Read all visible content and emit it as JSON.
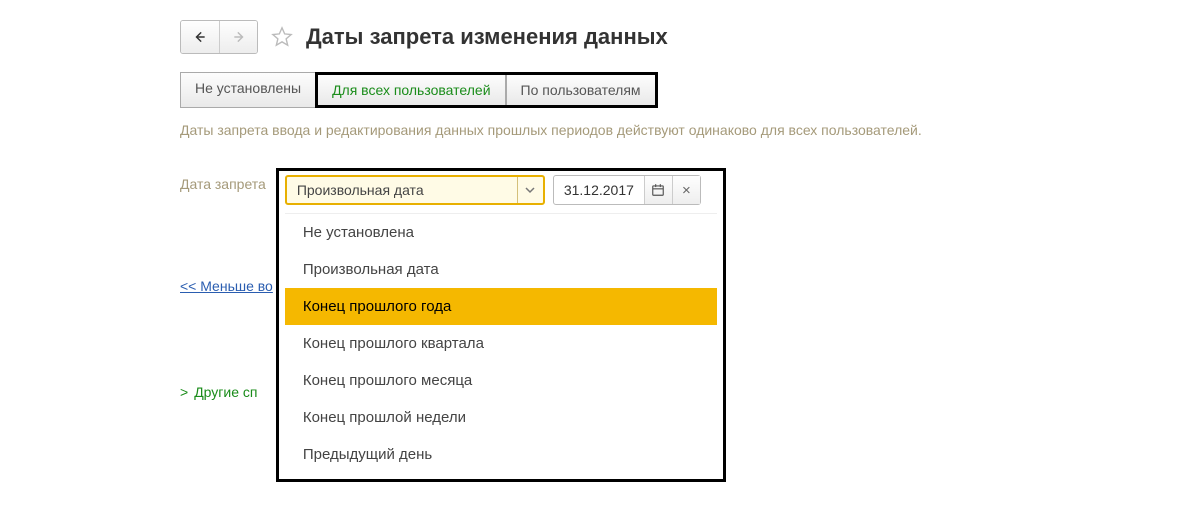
{
  "header": {
    "title": "Даты запрета изменения данных"
  },
  "tabs": {
    "not_set": "Не установлены",
    "for_all": "Для всех пользователей",
    "by_users": "По пользователям"
  },
  "description": "Даты запрета ввода и редактирования данных прошлых периодов действуют одинаково для всех пользователей.",
  "field": {
    "label": "Дата запрета",
    "selected": "Произвольная дата",
    "date_value": "31.12.2017"
  },
  "options": [
    "Не установлена",
    "Произвольная дата",
    "Конец прошлого года",
    "Конец прошлого квартала",
    "Конец прошлого месяца",
    "Конец прошлой недели",
    "Предыдущий день"
  ],
  "links": {
    "less": "<< Меньше во",
    "other": "Другие сп"
  },
  "icons": {
    "clear": "×"
  },
  "highlight_index": 2
}
